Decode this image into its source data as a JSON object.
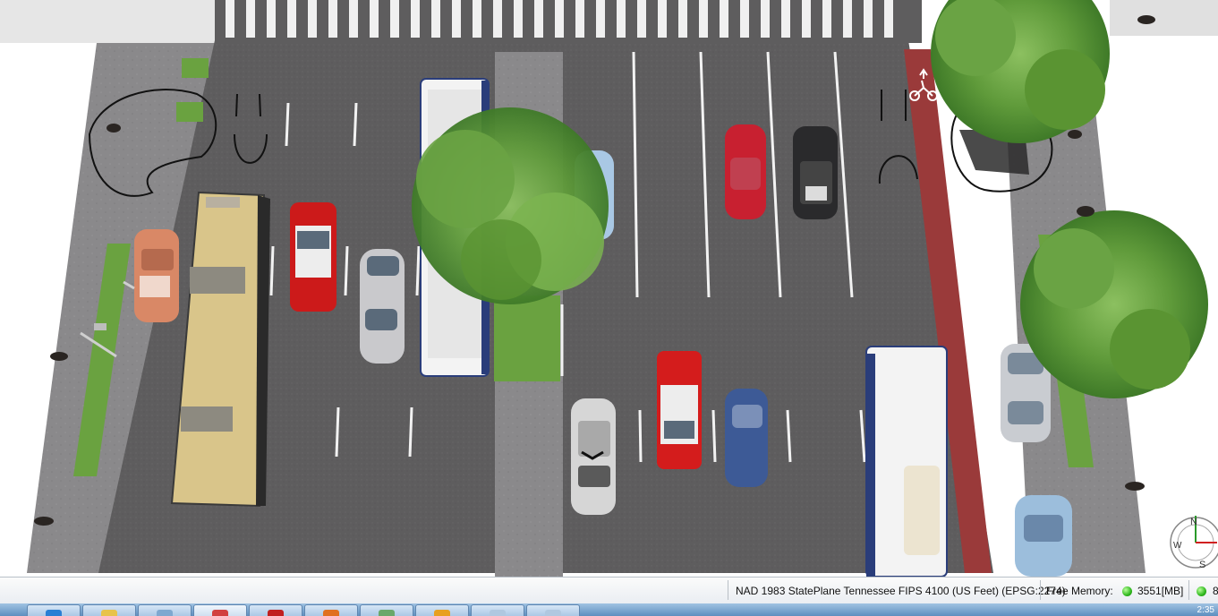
{
  "scene": {
    "description_icon": "3d-street-scene",
    "compass": {
      "north_label": "N",
      "south_label": "S",
      "east_label": "E",
      "west_label": "W"
    }
  },
  "statusbar": {
    "crs": "NAD 1983 StatePlane Tennessee FIPS 4100 (US Feet) (EPSG:2274)",
    "free_memory_label": "Free Memory:",
    "free_memory_value": "3551[MB]",
    "second_indicator_value": "8",
    "indicator_color": "#2fb81e"
  },
  "taskbar": {
    "buttons": [
      {
        "icon": "ie-icon",
        "color": "#2a7fd4"
      },
      {
        "icon": "folder-icon",
        "color": "#e8c34a"
      },
      {
        "icon": "app-icon",
        "color": "#7fa8d0"
      },
      {
        "icon": "app-red-icon",
        "color": "#d24040"
      },
      {
        "icon": "app-red2-icon",
        "color": "#c02020"
      },
      {
        "icon": "firefox-icon",
        "color": "#e07020"
      },
      {
        "icon": "app-green-icon",
        "color": "#6aa86a"
      },
      {
        "icon": "app-yellow-icon",
        "color": "#e8a020"
      },
      {
        "icon": "mail-icon",
        "color": "#b0c8e0"
      },
      {
        "icon": "mail2-icon",
        "color": "#b0c8e0"
      }
    ],
    "clock": "2:35"
  }
}
